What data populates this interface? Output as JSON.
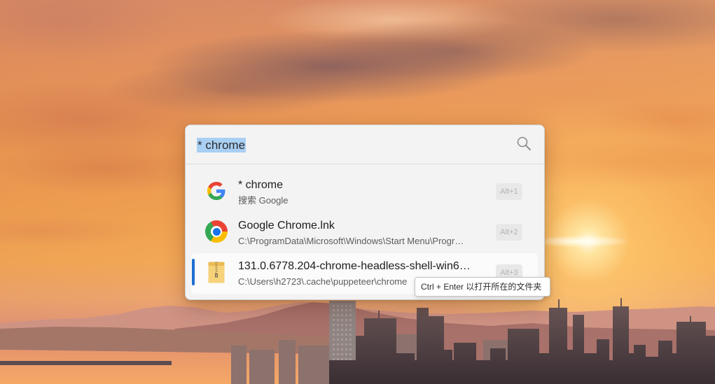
{
  "search": {
    "query": "* chrome",
    "icon": "search-icon"
  },
  "results": [
    {
      "icon": "google-g-icon",
      "title": "* chrome",
      "subtitle": "搜索 Google",
      "hotkey": "Alt+1",
      "selected": false
    },
    {
      "icon": "chrome-icon",
      "title": "Google Chrome.lnk",
      "subtitle": "C:\\ProgramData\\Microsoft\\Windows\\Start Menu\\Progr…",
      "hotkey": "Alt+2",
      "selected": false
    },
    {
      "icon": "zip-folder-icon",
      "title": "131.0.6778.204-chrome-headless-shell-win6…",
      "subtitle": "C:\\Users\\h2723\\.cache\\puppeteer\\chrome",
      "hotkey": "Alt+3",
      "selected": true
    }
  ],
  "tooltip": {
    "text": "Ctrl + Enter 以打开所在的文件夹"
  },
  "colors": {
    "accent": "#1f6fd1",
    "selection_highlight": "#a9cff3",
    "launcher_background": "#f3f3f3",
    "selected_row_background": "#fbfbfb"
  }
}
